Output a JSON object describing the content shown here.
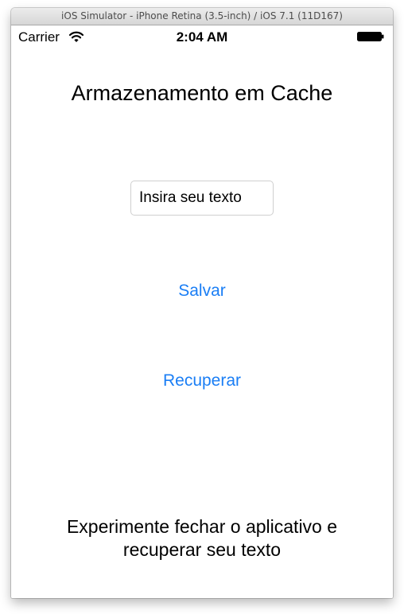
{
  "window": {
    "title": "iOS Simulator - iPhone Retina (3.5-inch) / iOS 7.1 (11D167)"
  },
  "status_bar": {
    "carrier": "Carrier",
    "time": "2:04 AM",
    "icons": [
      "wifi-icon",
      "battery-icon"
    ]
  },
  "main": {
    "title": "Armazenamento em Cache",
    "text_field": {
      "placeholder": "Insira seu texto",
      "value": ""
    },
    "save_label": "Salvar",
    "recover_label": "Recuperar",
    "footer_line1": "Experimente fechar o aplicativo e",
    "footer_line2": "recuperar seu texto"
  },
  "colors": {
    "link": "#1a7ef5",
    "text": "#000000",
    "background": "#ffffff"
  }
}
